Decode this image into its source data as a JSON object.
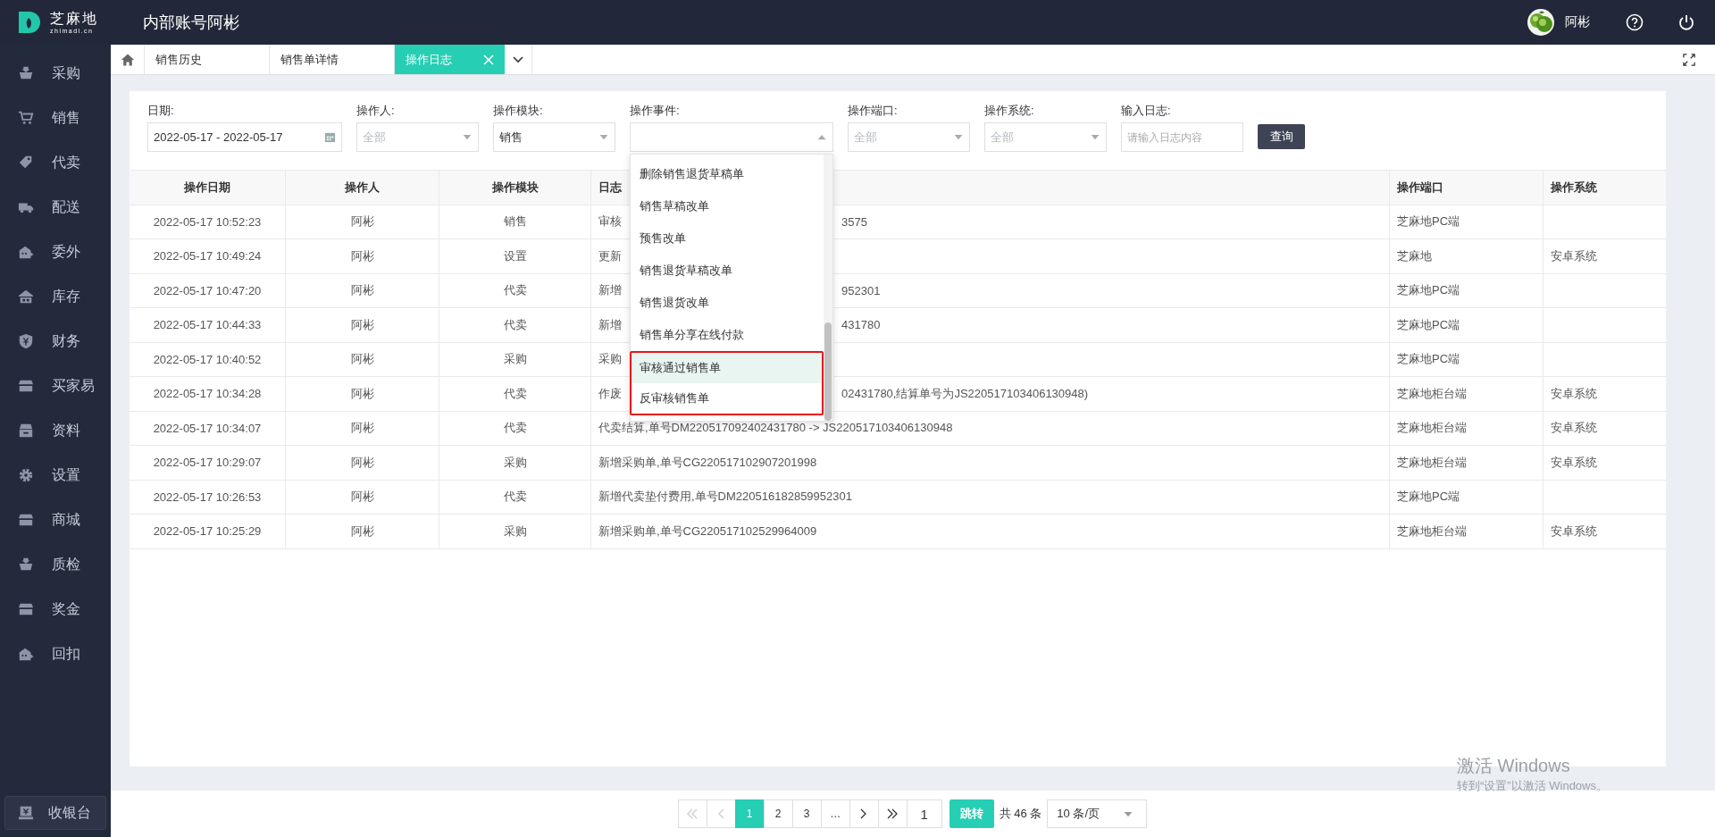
{
  "brand": {
    "name": "芝麻地",
    "domain": "zhimadi.cn"
  },
  "header": {
    "title": "内部账号阿彬",
    "user": "阿彬"
  },
  "sidebar": {
    "items": [
      {
        "label": "采购"
      },
      {
        "label": "销售"
      },
      {
        "label": "代卖"
      },
      {
        "label": "配送"
      },
      {
        "label": "委外"
      },
      {
        "label": "库存"
      },
      {
        "label": "财务"
      },
      {
        "label": "买家易"
      },
      {
        "label": "资料"
      },
      {
        "label": "设置"
      },
      {
        "label": "商城"
      },
      {
        "label": "质检"
      },
      {
        "label": "奖金"
      },
      {
        "label": "回扣"
      }
    ],
    "cashier": "收银台"
  },
  "tabs": [
    {
      "label": "销售历史",
      "selected": false,
      "closable": false
    },
    {
      "label": "销售单详情",
      "selected": false,
      "closable": false
    },
    {
      "label": "操作日志",
      "selected": true,
      "closable": true
    }
  ],
  "filters": [
    {
      "label": "日期:",
      "kind": "date",
      "value": "2022-05-17 - 2022-05-17"
    },
    {
      "label": "操作人:",
      "kind": "select",
      "value": "全部",
      "disabled": true,
      "expanded": false
    },
    {
      "label": "操作模块:",
      "kind": "select",
      "value": "销售",
      "disabled": false,
      "expanded": false
    },
    {
      "label": "操作事件:",
      "kind": "select",
      "disabled": false,
      "expanded": true,
      "options": [
        {
          "label": "删除销售退货草稿单",
          "selected": false,
          "marked": false
        },
        {
          "label": "销售草稿改单",
          "selected": false,
          "marked": false
        },
        {
          "label": "预售改单",
          "selected": false,
          "marked": false
        },
        {
          "label": "销售退货草稿改单",
          "selected": false,
          "marked": false
        },
        {
          "label": "销售退货改单",
          "selected": false,
          "marked": false
        },
        {
          "label": "销售单分享在线付款",
          "selected": false,
          "marked": false
        },
        {
          "label": "审核通过销售单",
          "selected": true,
          "marked": true
        },
        {
          "label": "反审核销售单",
          "selected": false,
          "marked": true
        }
      ]
    },
    {
      "label": "操作端口:",
      "kind": "select",
      "value": "全部",
      "disabled": true,
      "expanded": false
    },
    {
      "label": "操作系统:",
      "kind": "select",
      "value": "全部",
      "disabled": true,
      "expanded": false
    },
    {
      "label": "输入日志:",
      "kind": "text",
      "placeholder": "请输入日志内容"
    }
  ],
  "search_button": "查询",
  "table": {
    "columns": [
      "操作日期",
      "操作人",
      "操作模块",
      "日志",
      "操作端口",
      "操作系统"
    ],
    "rows": [
      {
        "date": "2022-05-17 10:52:23",
        "operator": "阿彬",
        "module": "销售",
        "log": [
          "审核",
          "3575"
        ],
        "port": "芝麻地PC端",
        "system": ""
      },
      {
        "date": "2022-05-17 10:49:24",
        "operator": "阿彬",
        "module": "设置",
        "log": [
          "更新"
        ],
        "port": "芝麻地",
        "system": "安卓系统"
      },
      {
        "date": "2022-05-17 10:47:20",
        "operator": "阿彬",
        "module": "代卖",
        "log": [
          "新增",
          "952301"
        ],
        "port": "芝麻地PC端",
        "system": ""
      },
      {
        "date": "2022-05-17 10:44:33",
        "operator": "阿彬",
        "module": "代卖",
        "log": [
          "新增",
          "431780"
        ],
        "port": "芝麻地PC端",
        "system": ""
      },
      {
        "date": "2022-05-17 10:40:52",
        "operator": "阿彬",
        "module": "采购",
        "log": [
          "采购"
        ],
        "port": "芝麻地PC端",
        "system": ""
      },
      {
        "date": "2022-05-17 10:34:28",
        "operator": "阿彬",
        "module": "代卖",
        "log": [
          "作废",
          "02431780,结算单号为JS220517103406130948)"
        ],
        "port": "芝麻地柜台端",
        "system": "安卓系统"
      },
      {
        "date": "2022-05-17 10:34:07",
        "operator": "阿彬",
        "module": "代卖",
        "log": [
          "代卖结算,单号DM220517092402431780 -> JS220517103406130948"
        ],
        "port": "芝麻地柜台端",
        "system": "安卓系统"
      },
      {
        "date": "2022-05-17 10:29:07",
        "operator": "阿彬",
        "module": "采购",
        "log": [
          "新增采购单,单号CG220517102907201998"
        ],
        "port": "芝麻地柜台端",
        "system": "安卓系统"
      },
      {
        "date": "2022-05-17 10:26:53",
        "operator": "阿彬",
        "module": "代卖",
        "log": [
          "新增代卖垫付费用,单号DM220516182859952301"
        ],
        "port": "芝麻地PC端",
        "system": ""
      },
      {
        "date": "2022-05-17 10:25:29",
        "operator": "阿彬",
        "module": "采购",
        "log": [
          "新增采购单,单号CG220517102529964009"
        ],
        "port": "芝麻地柜台端",
        "system": "安卓系统"
      }
    ]
  },
  "pagination": {
    "pages": [
      {
        "label": "1",
        "selected": true
      },
      {
        "label": "2",
        "selected": false
      },
      {
        "label": "3",
        "selected": false
      },
      {
        "label": "…",
        "selected": false
      }
    ],
    "jump_value": "1",
    "jump_button": "跳转",
    "total": "共 46 条",
    "page_size": "10 条/页"
  },
  "os_notice": {
    "title": "激活 Windows",
    "hint": "转到“设置”以激活 Windows。"
  }
}
